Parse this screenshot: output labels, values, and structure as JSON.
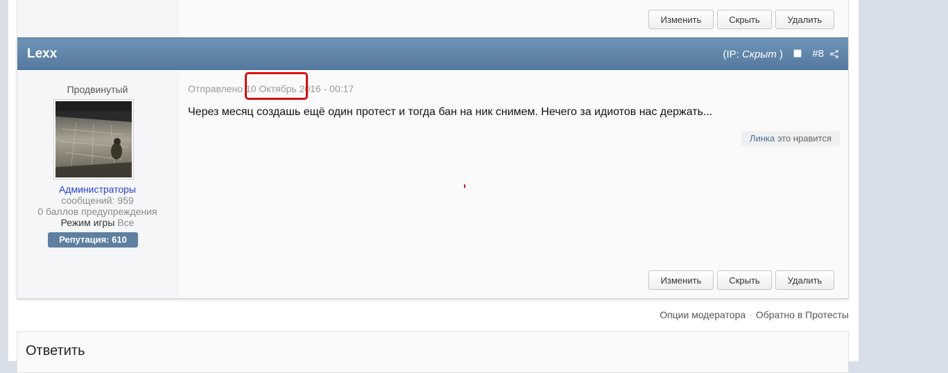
{
  "top_post": {
    "buttons": {
      "edit": "Изменить",
      "hide": "Скрыть",
      "delete": "Удалить"
    }
  },
  "post": {
    "author": "Lexx",
    "ip_prefix": "(IP: ",
    "ip_value": "Скрыт",
    "ip_suffix": " )",
    "number": "#8",
    "rank": "Продвинутый",
    "group": "Администраторы",
    "posts_count": "сообщений: 959",
    "warnings": "0 баллов предупреждения",
    "game_mode_label": "Режим игры",
    "game_mode_value": "Все",
    "reputation": "Репутация: 610",
    "meta_prefix": "Отправлено",
    "meta_date": "10 Октябрь",
    "meta_year_time": "2016 - 00:17",
    "text": "Через месяц создашь ещё один протест и тогда бан на ник снимем. Нечего за идиотов нас держать...",
    "liker": "Линка",
    "likes_suffix": "это нравится",
    "buttons": {
      "edit": "Изменить",
      "hide": "Скрыть",
      "delete": "Удалить"
    }
  },
  "footer": {
    "mod_options": "Опции модератора",
    "separator": "·",
    "back_link": "Обратно в Протесты"
  },
  "reply": {
    "title": "Ответить"
  },
  "colors": {
    "header_bg": "#5f84a9",
    "reputation_bg": "#5e7fa0",
    "highlight": "#d90f0f",
    "group_link": "#2a3fd6"
  },
  "icons": [
    "share-icon",
    "checkbox-icon",
    "avatar-image"
  ]
}
